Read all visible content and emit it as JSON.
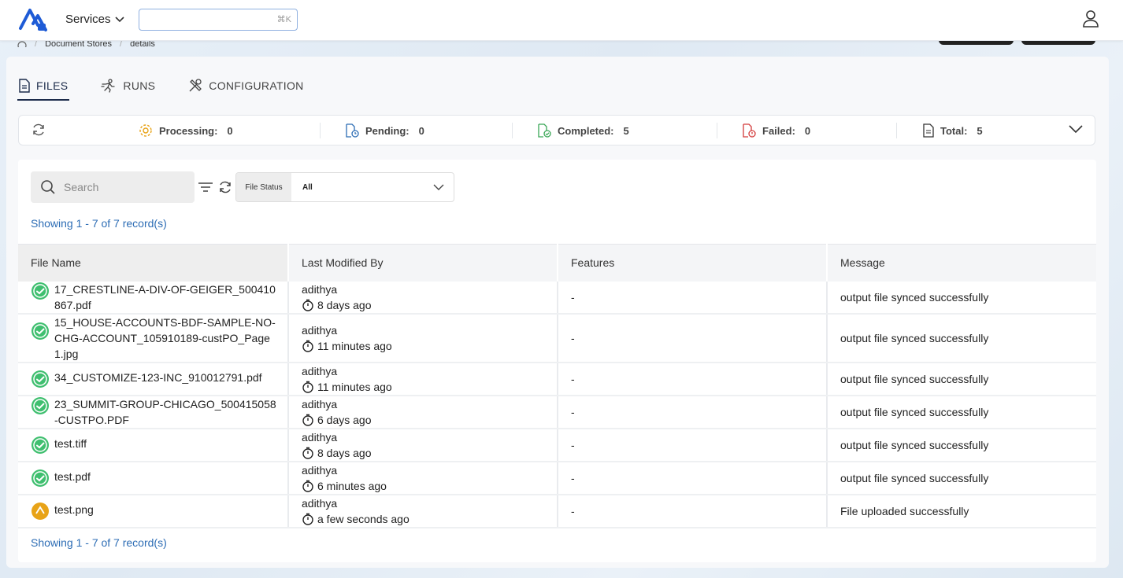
{
  "header": {
    "services_label": "Services",
    "search_shortcut": "⌘K"
  },
  "breadcrumb": {
    "store": "Document Stores",
    "current": "details"
  },
  "tabs": [
    {
      "label": "FILES",
      "icon": "document-icon",
      "active": true
    },
    {
      "label": "RUNS",
      "icon": "runner-icon",
      "active": false
    },
    {
      "label": "CONFIGURATION",
      "icon": "tools-icon",
      "active": false
    }
  ],
  "summary": {
    "processing": {
      "label": "Processing:",
      "value": "0",
      "color": "#e8a317"
    },
    "pending": {
      "label": "Pending:",
      "value": "0",
      "color": "#2d6db5"
    },
    "completed": {
      "label": "Completed:",
      "value": "5",
      "color": "#3aa757"
    },
    "failed": {
      "label": "Failed:",
      "value": "0",
      "color": "#d33c3c"
    },
    "total": {
      "label": "Total:",
      "value": "5"
    }
  },
  "filters": {
    "search_placeholder": "Search",
    "status_label": "File Status",
    "status_value": "All"
  },
  "records_text": "Showing 1 - 7 of 7 record(s)",
  "table": {
    "columns": [
      "File Name",
      "Last Modified By",
      "Features",
      "Message"
    ],
    "rows": [
      {
        "status": "completed",
        "file": "17_CRESTLINE-A-DIV-OF-GEIGER_500410867.pdf",
        "user": "adithya",
        "time": "8 days ago",
        "features": "-",
        "message": "output file synced successfully"
      },
      {
        "status": "completed",
        "file": "15_HOUSE-ACCOUNTS-BDF-SAMPLE-NO-CHG-ACCOUNT_105910189-custPO_Page1.jpg",
        "user": "adithya",
        "time": "11 minutes ago",
        "features": "-",
        "message": "output file synced successfully"
      },
      {
        "status": "completed",
        "file": "34_CUSTOMIZE-123-INC_910012791.pdf",
        "user": "adithya",
        "time": "11 minutes ago",
        "features": "-",
        "message": "output file synced successfully"
      },
      {
        "status": "completed",
        "file": "23_SUMMIT-GROUP-CHICAGO_500415058-CUSTPO.PDF",
        "user": "adithya",
        "time": "6 days ago",
        "features": "-",
        "message": "output file synced successfully"
      },
      {
        "status": "completed",
        "file": "test.tiff",
        "user": "adithya",
        "time": "8 days ago",
        "features": "-",
        "message": "output file synced successfully"
      },
      {
        "status": "completed",
        "file": "test.pdf",
        "user": "adithya",
        "time": "6 minutes ago",
        "features": "-",
        "message": "output file synced successfully"
      },
      {
        "status": "uploaded",
        "file": "test.png",
        "user": "adithya",
        "time": "a few seconds ago",
        "features": "-",
        "message": "File uploaded successfully"
      }
    ]
  },
  "colors": {
    "completed": "#3fbf6f",
    "uploaded": "#e8a317",
    "link": "#2d6db5",
    "tab_active": "#1c2b4a"
  }
}
